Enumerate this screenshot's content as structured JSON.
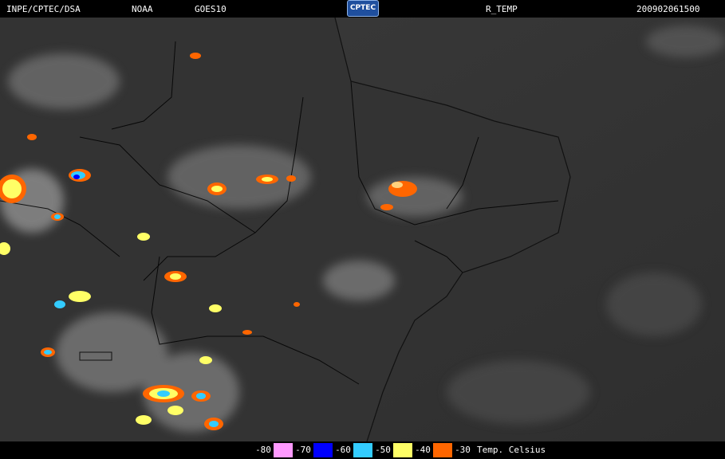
{
  "header": {
    "agency": "INPE/CPTEC/DSA",
    "source": "NOAA",
    "satellite": "GOES10",
    "logo": "CPTEC",
    "product": "R_TEMP",
    "timestamp": "200902061500"
  },
  "legend": {
    "items": [
      {
        "label": "-80",
        "color": "#ff99ff"
      },
      {
        "label": "-70",
        "color": "#0000ff"
      },
      {
        "label": "-60",
        "color": "#33ccff"
      },
      {
        "label": "-50",
        "color": "#ffff66"
      },
      {
        "label": "-40",
        "color": "#ff6600"
      },
      {
        "label": "-30",
        "color": "#ff6600"
      }
    ],
    "caption": "Temp. Celsius"
  }
}
